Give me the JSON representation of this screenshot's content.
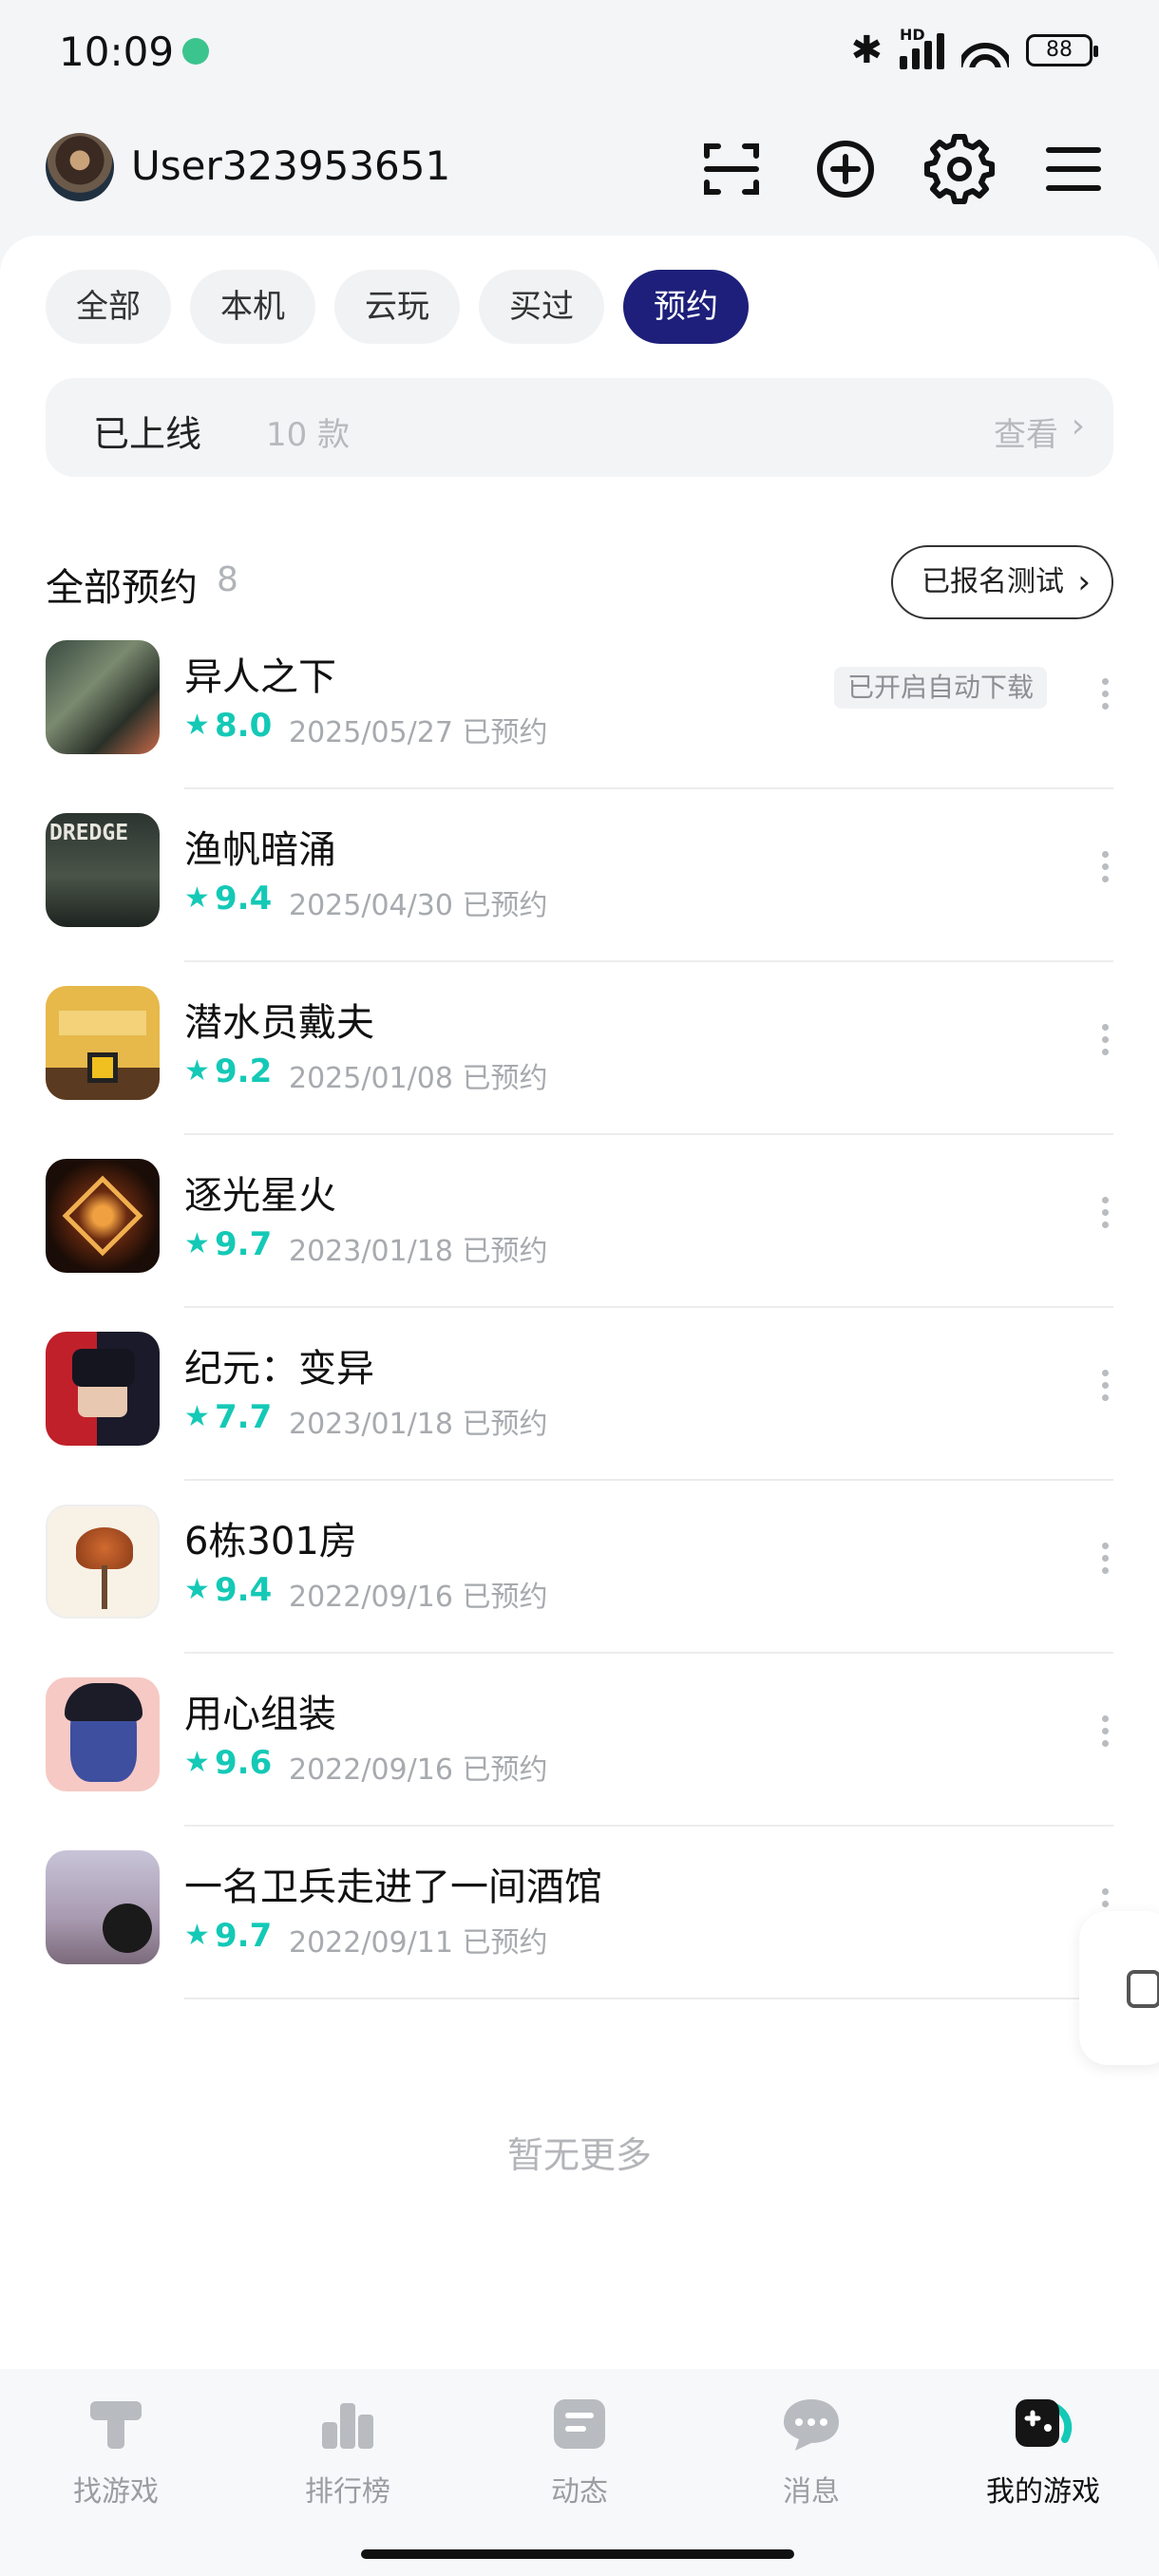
{
  "status_bar": {
    "time": "10:09",
    "signal_label": "HD",
    "battery": "88"
  },
  "header": {
    "username": "User323953651"
  },
  "filters": [
    {
      "label": "全部",
      "active": false
    },
    {
      "label": "本机",
      "active": false
    },
    {
      "label": "云玩",
      "active": false
    },
    {
      "label": "买过",
      "active": false
    },
    {
      "label": "预约",
      "active": true
    }
  ],
  "online_banner": {
    "label": "已上线",
    "count": "10 款",
    "view": "查看"
  },
  "section": {
    "title": "全部预约",
    "count": "8",
    "test_button": "已报名测试"
  },
  "games": [
    {
      "name": "异人之下",
      "score": "8.0",
      "date": "2025/05/27 已预约",
      "badge": "已开启自动下载"
    },
    {
      "name": "渔帆暗涌",
      "score": "9.4",
      "date": "2025/04/30 已预约",
      "icon_text": "DREDGE"
    },
    {
      "name": "潜水员戴夫",
      "score": "9.2",
      "date": "2025/01/08 已预约"
    },
    {
      "name": "逐光星火",
      "score": "9.7",
      "date": "2023/01/18 已预约"
    },
    {
      "name": "纪元：变异",
      "score": "7.7",
      "date": "2023/01/18 已预约"
    },
    {
      "name": "6栋301房",
      "score": "9.4",
      "date": "2022/09/16 已预约"
    },
    {
      "name": "用心组装",
      "score": "9.6",
      "date": "2022/09/16 已预约"
    },
    {
      "name": "一名卫兵走进了一间酒馆",
      "score": "9.7",
      "date": "2022/09/11 已预约"
    }
  ],
  "footer_text": "暂无更多",
  "bottom_nav": [
    {
      "label": "找游戏",
      "icon": "find-games-icon"
    },
    {
      "label": "排行榜",
      "icon": "leaderboard-icon"
    },
    {
      "label": "动态",
      "icon": "feed-icon"
    },
    {
      "label": "消息",
      "icon": "messages-icon"
    },
    {
      "label": "我的游戏",
      "icon": "my-games-icon"
    }
  ],
  "colors": {
    "accent_chip": "#1d1f7a",
    "rating": "#14c9b6"
  }
}
